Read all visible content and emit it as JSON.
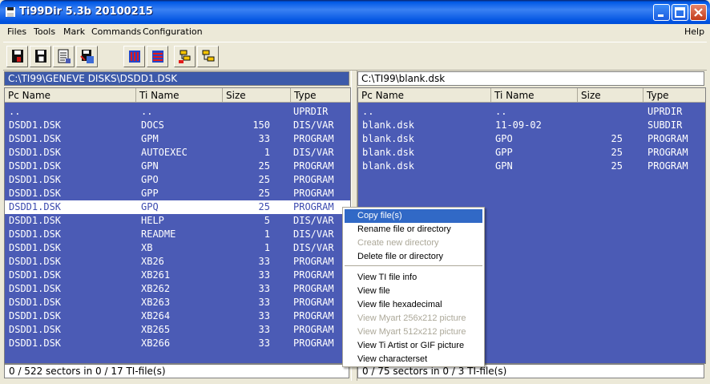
{
  "window": {
    "title": "Ti99Dir 5.3b 20100215"
  },
  "menu": {
    "files": "Files",
    "tools": "Tools",
    "mark": "Mark",
    "commands": "Commands",
    "configuration": "Configuration",
    "help": "Help"
  },
  "left": {
    "path": "C:\\TI99\\GENEVE DISKS\\DSDD1.DSK",
    "headers": {
      "pc": "Pc Name",
      "ti": "Ti Name",
      "size": "Size",
      "type": "Type"
    },
    "rows": [
      {
        "pc": "..",
        "ti": "..",
        "size": "",
        "type": "UPRDIR"
      },
      {
        "pc": "DSDD1.DSK",
        "ti": "DOCS",
        "size": "150",
        "type": "DIS/VAR"
      },
      {
        "pc": "DSDD1.DSK",
        "ti": "GPM",
        "size": "33",
        "type": "PROGRAM"
      },
      {
        "pc": "DSDD1.DSK",
        "ti": "AUTOEXEC",
        "size": "1",
        "type": "DIS/VAR"
      },
      {
        "pc": "DSDD1.DSK",
        "ti": "GPN",
        "size": "25",
        "type": "PROGRAM"
      },
      {
        "pc": "DSDD1.DSK",
        "ti": "GPO",
        "size": "25",
        "type": "PROGRAM"
      },
      {
        "pc": "DSDD1.DSK",
        "ti": "GPP",
        "size": "25",
        "type": "PROGRAM"
      },
      {
        "pc": "DSDD1.DSK",
        "ti": "GPQ",
        "size": "25",
        "type": "PROGRAM"
      },
      {
        "pc": "DSDD1.DSK",
        "ti": "HELP",
        "size": "5",
        "type": "DIS/VAR"
      },
      {
        "pc": "DSDD1.DSK",
        "ti": "README",
        "size": "1",
        "type": "DIS/VAR"
      },
      {
        "pc": "DSDD1.DSK",
        "ti": "XB",
        "size": "1",
        "type": "DIS/VAR"
      },
      {
        "pc": "DSDD1.DSK",
        "ti": "XB26",
        "size": "33",
        "type": "PROGRAM"
      },
      {
        "pc": "DSDD1.DSK",
        "ti": "XB261",
        "size": "33",
        "type": "PROGRAM"
      },
      {
        "pc": "DSDD1.DSK",
        "ti": "XB262",
        "size": "33",
        "type": "PROGRAM"
      },
      {
        "pc": "DSDD1.DSK",
        "ti": "XB263",
        "size": "33",
        "type": "PROGRAM"
      },
      {
        "pc": "DSDD1.DSK",
        "ti": "XB264",
        "size": "33",
        "type": "PROGRAM"
      },
      {
        "pc": "DSDD1.DSK",
        "ti": "XB265",
        "size": "33",
        "type": "PROGRAM"
      },
      {
        "pc": "DSDD1.DSK",
        "ti": "XB266",
        "size": "33",
        "type": "PROGRAM"
      }
    ],
    "selected_index": 7,
    "status": "0 / 522 sectors in 0 / 17 TI-file(s)"
  },
  "right": {
    "path": "C:\\TI99\\blank.dsk",
    "headers": {
      "pc": "Pc Name",
      "ti": "Ti Name",
      "size": "Size",
      "type": "Type"
    },
    "rows": [
      {
        "pc": "..",
        "ti": "..",
        "size": "",
        "type": "UPRDIR"
      },
      {
        "pc": "blank.dsk",
        "ti": "11-09-02",
        "size": "",
        "type": "SUBDIR"
      },
      {
        "pc": "blank.dsk",
        "ti": "GPO",
        "size": "25",
        "type": "PROGRAM"
      },
      {
        "pc": "blank.dsk",
        "ti": "GPP",
        "size": "25",
        "type": "PROGRAM"
      },
      {
        "pc": "blank.dsk",
        "ti": "GPN",
        "size": "25",
        "type": "PROGRAM"
      }
    ],
    "status": "0 / 75 sectors in 0 / 3 TI-file(s)"
  },
  "context_menu": [
    {
      "label": "Copy file(s)",
      "state": "highlighted"
    },
    {
      "label": "Rename file or directory",
      "state": "enabled"
    },
    {
      "label": "Create new directory",
      "state": "disabled"
    },
    {
      "label": "Delete file or directory",
      "state": "enabled"
    },
    {
      "label": "View TI file info",
      "state": "enabled"
    },
    {
      "label": "View file",
      "state": "enabled"
    },
    {
      "label": "View file hexadecimal",
      "state": "enabled"
    },
    {
      "label": "View Myart 256x212 picture",
      "state": "disabled"
    },
    {
      "label": "View Myart 512x212 picture",
      "state": "disabled"
    },
    {
      "label": "View Ti Artist or GIF picture",
      "state": "enabled"
    },
    {
      "label": "View characterset",
      "state": "enabled"
    }
  ],
  "colors": {
    "list_bg": "#4b5bb5",
    "path_active": "#3d5aaa",
    "highlight": "#3169c6"
  }
}
